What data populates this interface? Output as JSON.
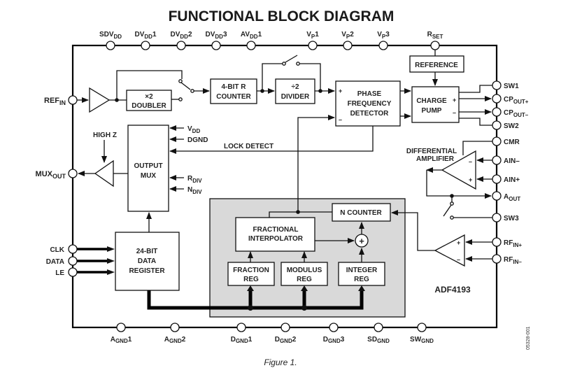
{
  "title": "FUNCTIONAL BLOCK DIAGRAM",
  "caption": "Figure 1.",
  "figure_id": "05328-001",
  "chip_name": "ADF4193",
  "colors": {
    "core_fill": "#d9d9d9",
    "line": "#111111",
    "background": "#ffffff"
  },
  "top_pins": [
    {
      "main": "SDV",
      "sub": "DD",
      "suffix": ""
    },
    {
      "main": "DV",
      "sub": "DD",
      "suffix": "1"
    },
    {
      "main": "DV",
      "sub": "DD",
      "suffix": "2"
    },
    {
      "main": "DV",
      "sub": "DD",
      "suffix": "3"
    },
    {
      "main": "AV",
      "sub": "DD",
      "suffix": "1"
    },
    {
      "main": "V",
      "sub": "P",
      "suffix": "1"
    },
    {
      "main": "V",
      "sub": "P",
      "suffix": "2"
    },
    {
      "main": "V",
      "sub": "P",
      "suffix": "3"
    },
    {
      "main": "R",
      "sub": "SET",
      "suffix": ""
    }
  ],
  "bottom_pins": [
    {
      "main": "A",
      "sub": "GND",
      "suffix": "1"
    },
    {
      "main": "A",
      "sub": "GND",
      "suffix": "2"
    },
    {
      "main": "D",
      "sub": "GND",
      "suffix": "1"
    },
    {
      "main": "D",
      "sub": "GND",
      "suffix": "2"
    },
    {
      "main": "D",
      "sub": "GND",
      "suffix": "3"
    },
    {
      "main": "SD",
      "sub": "GND",
      "suffix": ""
    },
    {
      "main": "SW",
      "sub": "GND",
      "suffix": ""
    }
  ],
  "left_pins": {
    "refin": {
      "main": "REF",
      "sub": "IN"
    },
    "muxout": {
      "main": "MUX",
      "sub": "OUT"
    },
    "clk": "CLK",
    "data": "DATA",
    "le": "LE"
  },
  "right_pins": {
    "sw1": "SW1",
    "cpout_plus": {
      "main": "CP",
      "sub": "OUT+"
    },
    "cpout_minus": {
      "main": "CP",
      "sub": "OUT–"
    },
    "sw2": "SW2",
    "cmr": "CMR",
    "ain_minus": "AIN–",
    "ain_plus": "AIN+",
    "aout": {
      "main": "A",
      "sub": "OUT"
    },
    "sw3": "SW3",
    "rfin_plus": {
      "main": "RF",
      "sub": "IN+"
    },
    "rfin_minus": {
      "main": "RF",
      "sub": "IN–"
    }
  },
  "blocks": {
    "doubler": [
      "×2",
      "DOUBLER"
    ],
    "r_counter": [
      "4-BIT R",
      "COUNTER"
    ],
    "divider": [
      "÷2",
      "DIVIDER"
    ],
    "pfd": [
      "PHASE",
      "FREQUENCY",
      "DETECTOR"
    ],
    "reference": "REFERENCE",
    "charge_pump": [
      "CHARGE",
      "PUMP"
    ],
    "output_mux": [
      "OUTPUT",
      "MUX"
    ],
    "data_register": [
      "24-BIT",
      "DATA",
      "REGISTER"
    ],
    "frac_interp": [
      "FRACTIONAL",
      "INTERPOLATOR"
    ],
    "n_counter": "N COUNTER",
    "fraction_reg": [
      "FRACTION",
      "REG"
    ],
    "modulus_reg": [
      "MODULUS",
      "REG"
    ],
    "integer_reg": [
      "INTEGER",
      "REG"
    ]
  },
  "labels": {
    "high_z": "HIGH Z",
    "lock_detect": "LOCK DETECT",
    "diff_amp": [
      "DIFFERENTIAL",
      "AMPLIFIER"
    ],
    "mux_vdd": {
      "main": "V",
      "sub": "DD"
    },
    "mux_dgnd": "DGND",
    "mux_rdiv": {
      "main": "R",
      "sub": "DIV"
    },
    "mux_ndiv": {
      "main": "N",
      "sub": "DIV"
    },
    "plus": "+",
    "minus": "–",
    "sum": "+"
  }
}
